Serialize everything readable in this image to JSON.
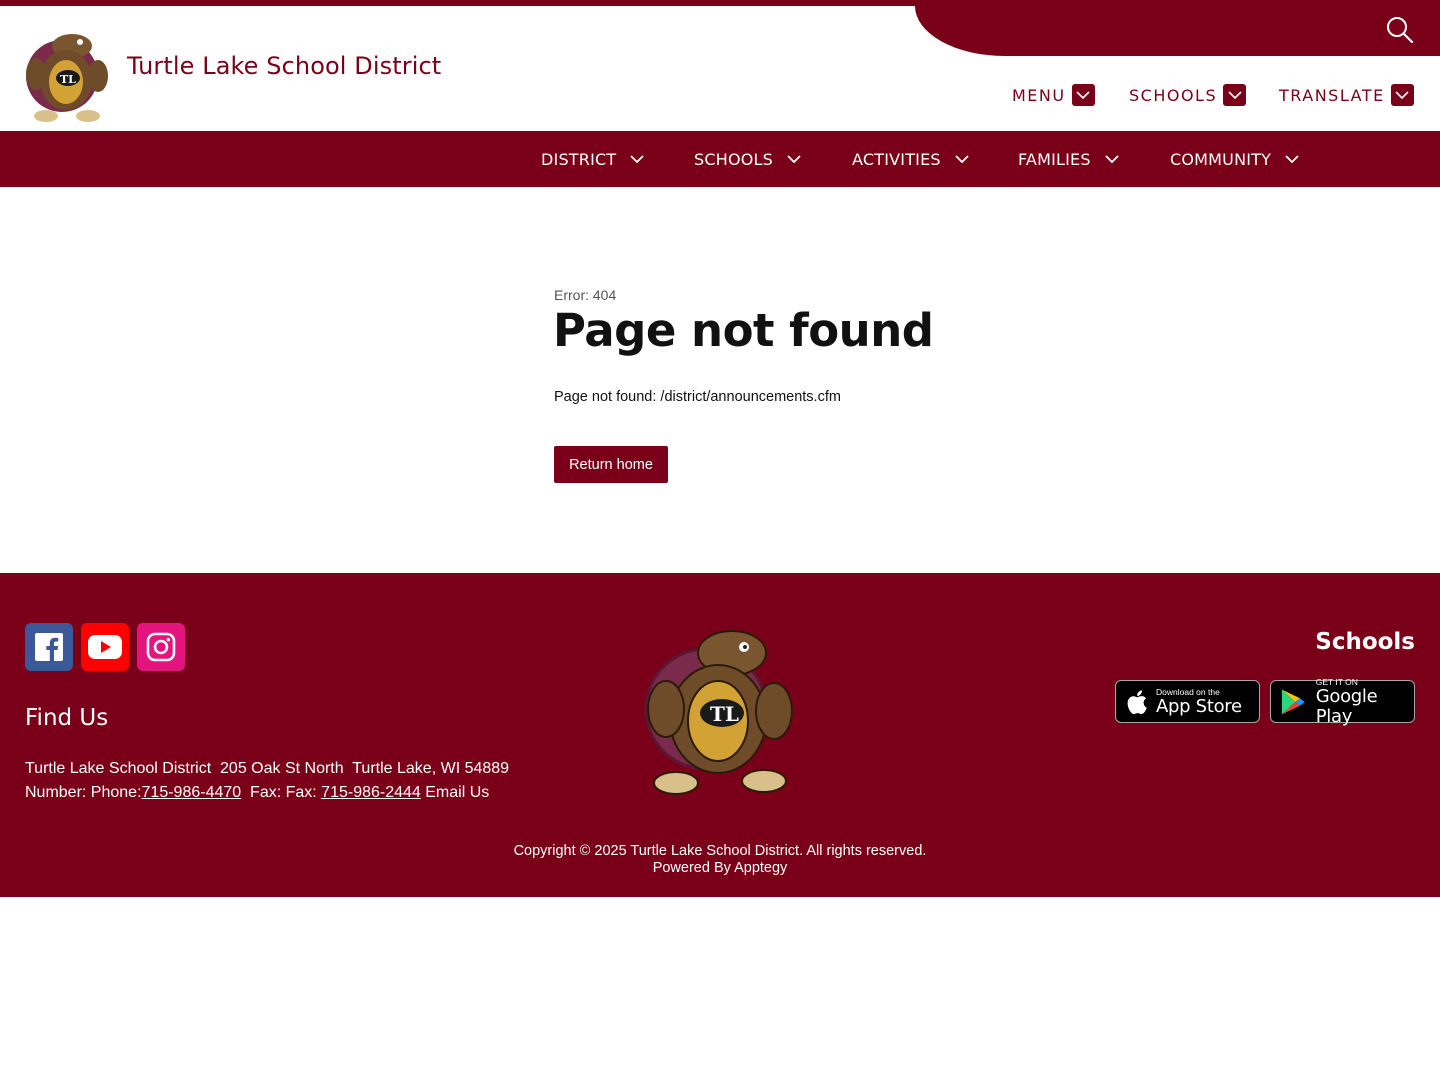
{
  "header": {
    "site_title": "Turtle Lake School District",
    "utility_nav": [
      {
        "label": "MENU"
      },
      {
        "label": "SCHOOLS"
      },
      {
        "label": "TRANSLATE"
      }
    ],
    "search_icon": "search-icon",
    "logo_letters": "TL"
  },
  "main_nav": [
    {
      "label": "DISTRICT"
    },
    {
      "label": "SCHOOLS"
    },
    {
      "label": "ACTIVITIES"
    },
    {
      "label": "FAMILIES"
    },
    {
      "label": "COMMUNITY"
    }
  ],
  "content": {
    "error_code": "Error: 404",
    "title": "Page not found",
    "message": "Page not found: /district/announcements.cfm",
    "return_button": "Return home"
  },
  "footer": {
    "social": [
      {
        "name": "facebook-icon",
        "color": "#3b5998"
      },
      {
        "name": "youtube-icon",
        "color": "#ff0000"
      },
      {
        "name": "instagram-icon",
        "color": "#e4147f"
      }
    ],
    "find_us_heading": "Find Us",
    "address_line": "Turtle Lake School District  205 Oak St North  Turtle Lake, WI 54889",
    "phone_prefix": "Number: Phone:",
    "phone": "715-986-4470",
    "fax_prefix": "  Fax: Fax: ",
    "fax": "715-986-2444",
    "email_link": " Email Us",
    "schools_heading": "Schools",
    "app_store": {
      "small": "Download on the",
      "big": "App Store"
    },
    "google_play": {
      "small": "GET IT ON",
      "big": "Google Play"
    },
    "copyright": "Copyright © 2025 Turtle Lake School District. All rights reserved.",
    "powered_by": "Powered By Apptegy"
  },
  "colors": {
    "brand": "#7a0019",
    "text": "#111111",
    "muted": "#555555"
  }
}
